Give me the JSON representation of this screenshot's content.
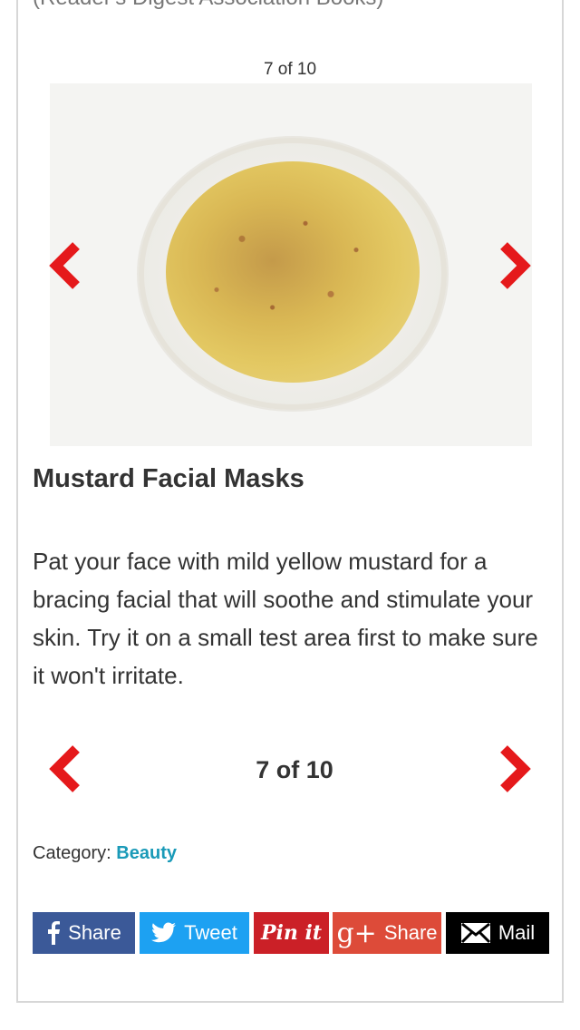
{
  "source_text": "(Reader's Digest Association Books)",
  "slideshow": {
    "counter_top": "7 of 10",
    "counter_bottom": "7 of 10",
    "current": 7,
    "total": 10
  },
  "article": {
    "title": "Mustard Facial Masks",
    "body": "Pat your face with mild yellow mustard for a bracing facial that will soothe and stimulate your skin. Try it on a small test area first to make sure it won't irritate."
  },
  "category": {
    "label": "Category:",
    "value": "Beauty"
  },
  "share": {
    "facebook_label": "Share",
    "twitter_label": "Tweet",
    "pinterest_label": "Pin it",
    "google_label": "Share",
    "google_icon_text": "g+",
    "mail_label": "Mail"
  },
  "colors": {
    "arrow": "#e5191b",
    "category_link": "#1a9ab8",
    "facebook": "#3b5998",
    "twitter": "#1da1f2",
    "pinterest": "#cb2027",
    "google": "#dd4b39",
    "mail": "#000000"
  },
  "icons": {
    "prev": "chevron-left-icon",
    "next": "chevron-right-icon",
    "facebook": "facebook-icon",
    "twitter": "twitter-icon",
    "google": "google-plus-icon",
    "mail": "envelope-icon"
  }
}
